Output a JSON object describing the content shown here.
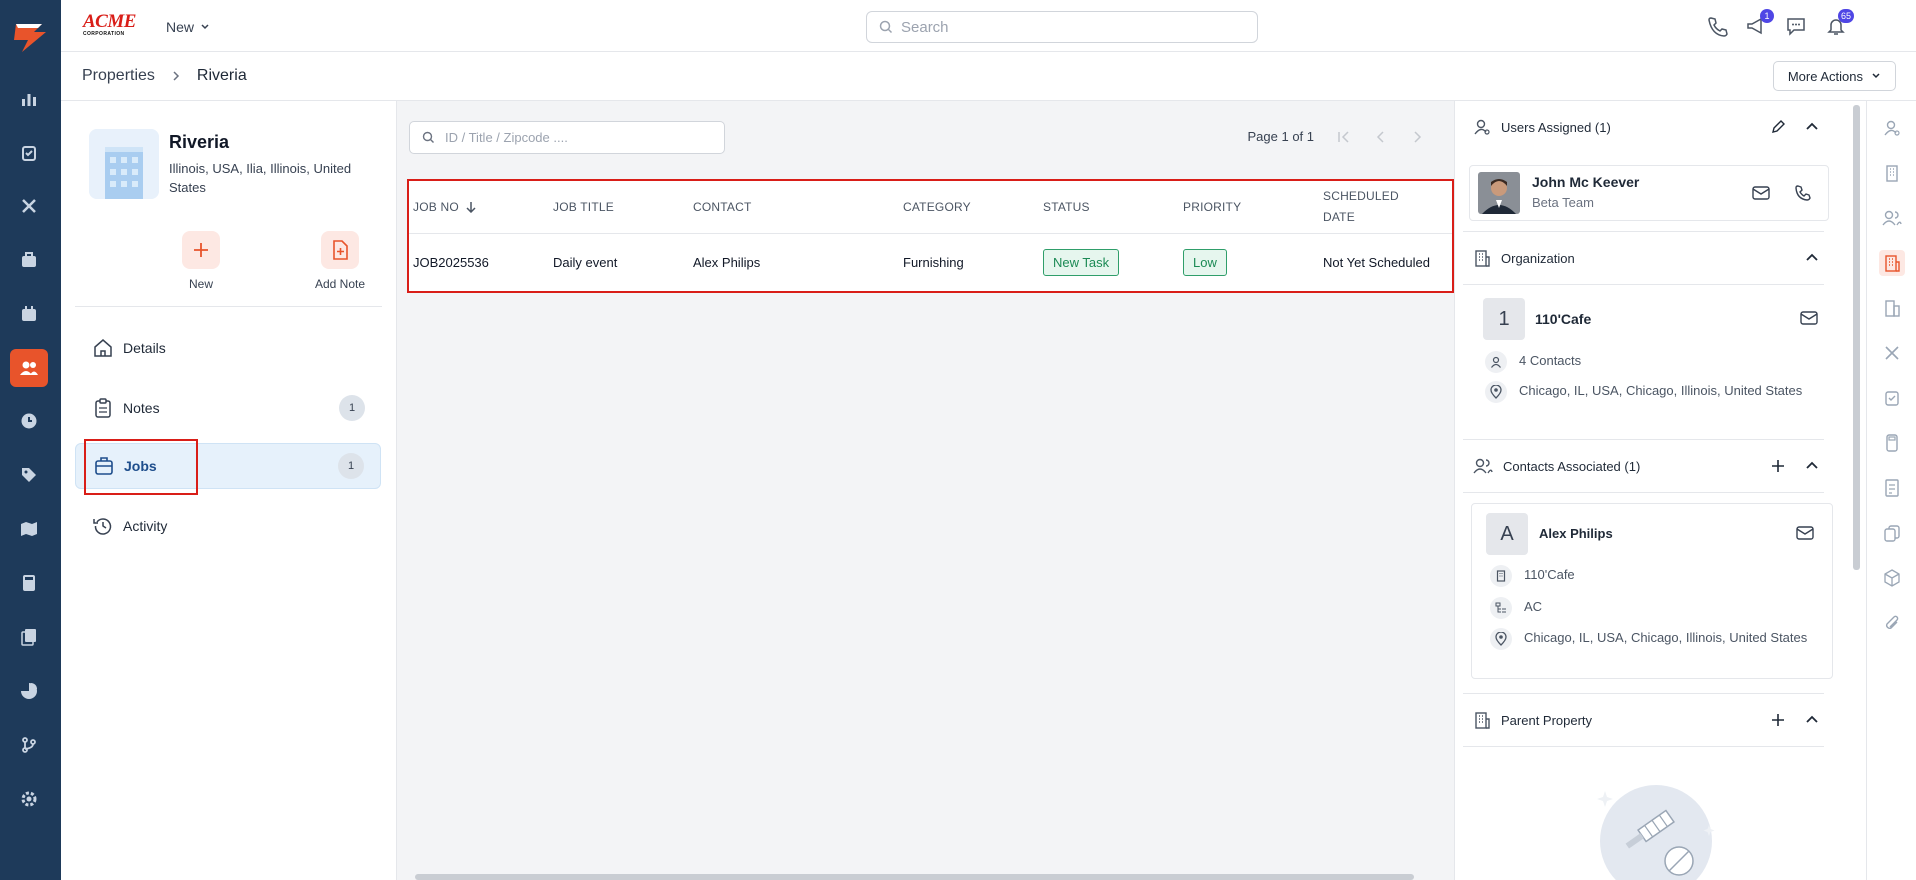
{
  "topbar": {
    "brand": "ACME",
    "brand_sub": "CORPORATION",
    "new_label": "New",
    "search_placeholder": "Search",
    "megaphone_badge": "1",
    "notification_badge": "65"
  },
  "breadcrumb": {
    "root": "Properties",
    "current": "Riveria",
    "more_actions": "More Actions"
  },
  "property": {
    "name": "Riveria",
    "address": "Illinois, USA, Ilia, Illinois, United States"
  },
  "quick_actions": [
    {
      "label": "New",
      "icon": "plus-icon"
    },
    {
      "label": "Add Note",
      "icon": "add-note-icon"
    }
  ],
  "menu": [
    {
      "label": "Details",
      "icon": "home-icon",
      "count": null
    },
    {
      "label": "Notes",
      "icon": "clipboard-icon",
      "count": "1"
    },
    {
      "label": "Jobs",
      "icon": "briefcase-icon",
      "count": "1",
      "active": true
    },
    {
      "label": "Activity",
      "icon": "history-icon",
      "count": null
    }
  ],
  "jobs": {
    "search_placeholder": "ID / Title / Zipcode ....",
    "page_info": "Page 1 of 1",
    "columns": [
      "JOB NO",
      "JOB TITLE",
      "CONTACT",
      "CATEGORY",
      "STATUS",
      "PRIORITY",
      "SCHEDULED",
      "DATE"
    ],
    "rows": [
      {
        "job_no": "JOB2025536",
        "title": "Daily event",
        "contact": "Alex Philips",
        "category": "Furnishing",
        "status": "New Task",
        "priority": "Low",
        "scheduled": "Not Yet Scheduled"
      }
    ]
  },
  "users_assigned": {
    "title": "Users Assigned (1)",
    "name": "John Mc Keever",
    "team": "Beta Team"
  },
  "organization": {
    "title": "Organization",
    "initial": "1",
    "name": "110'Cafe",
    "contacts": "4 Contacts",
    "address": "Chicago, IL, USA, Chicago, Illinois, United States"
  },
  "contacts_associated": {
    "title": "Contacts Associated (1)",
    "initial": "A",
    "name": "Alex Philips",
    "company": "110'Cafe",
    "type": "AC",
    "address": "Chicago, IL, USA, Chicago, Illinois, United States"
  },
  "parent_property": {
    "title": "Parent Property"
  },
  "colors": {
    "nav_bg": "#1e3a5a",
    "accent": "#e8542b",
    "highlight": "#d91e18",
    "status_green": "#2f9e6a"
  }
}
